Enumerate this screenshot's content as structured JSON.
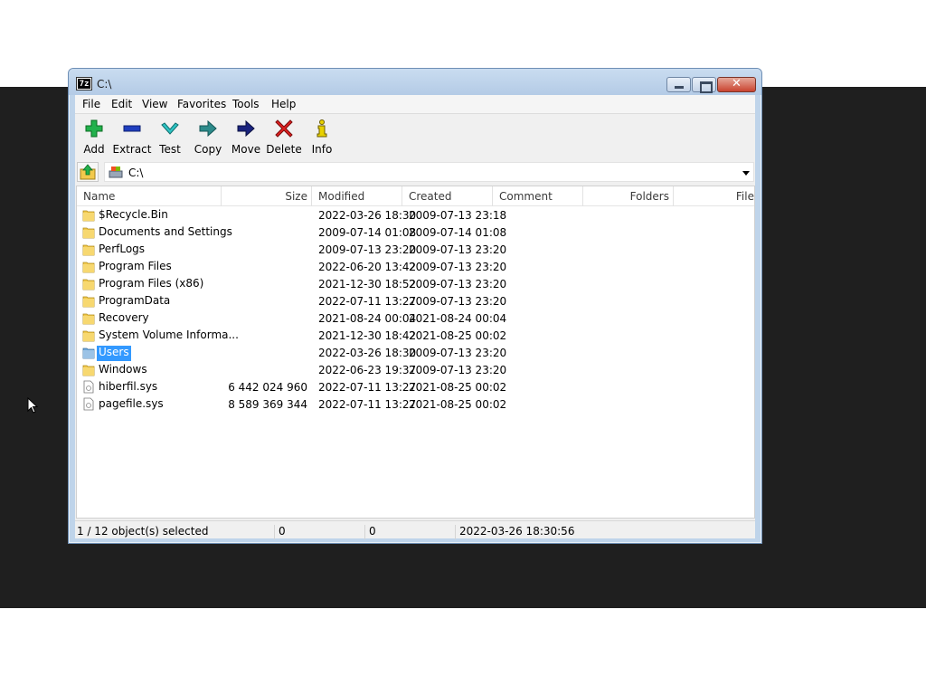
{
  "window": {
    "title": "C:\\",
    "app_icon_text": "7z"
  },
  "menu": [
    {
      "label": "File",
      "name": "menu-file"
    },
    {
      "label": "Edit",
      "name": "menu-edit"
    },
    {
      "label": "View",
      "name": "menu-view"
    },
    {
      "label": "Favorites",
      "name": "menu-favorites"
    },
    {
      "label": "Tools",
      "name": "menu-tools"
    },
    {
      "label": "Help",
      "name": "menu-help"
    }
  ],
  "toolbar": {
    "add": "Add",
    "extract": "Extract",
    "test": "Test",
    "copy": "Copy",
    "move": "Move",
    "delete": "Delete",
    "info": "Info"
  },
  "address": {
    "path": "C:\\"
  },
  "columns": {
    "name": "Name",
    "size": "Size",
    "modified": "Modified",
    "created": "Created",
    "comment": "Comment",
    "folders": "Folders",
    "files": "File"
  },
  "rows": [
    {
      "name": "$Recycle.Bin",
      "size": "",
      "modified": "2022-03-26 18:30",
      "created": "2009-07-13 23:18",
      "type": "folder"
    },
    {
      "name": "Documents and Settings",
      "size": "",
      "modified": "2009-07-14 01:08",
      "created": "2009-07-14 01:08",
      "type": "folder"
    },
    {
      "name": "PerfLogs",
      "size": "",
      "modified": "2009-07-13 23:20",
      "created": "2009-07-13 23:20",
      "type": "folder"
    },
    {
      "name": "Program Files",
      "size": "",
      "modified": "2022-06-20 13:42",
      "created": "2009-07-13 23:20",
      "type": "folder"
    },
    {
      "name": "Program Files (x86)",
      "size": "",
      "modified": "2021-12-30 18:52",
      "created": "2009-07-13 23:20",
      "type": "folder"
    },
    {
      "name": "ProgramData",
      "size": "",
      "modified": "2022-07-11 13:27",
      "created": "2009-07-13 23:20",
      "type": "folder"
    },
    {
      "name": "Recovery",
      "size": "",
      "modified": "2021-08-24 00:04",
      "created": "2021-08-24 00:04",
      "type": "folder"
    },
    {
      "name": "System Volume Informa...",
      "size": "",
      "modified": "2021-12-30 18:42",
      "created": "2021-08-25 00:02",
      "type": "folder"
    },
    {
      "name": "Users",
      "size": "",
      "modified": "2022-03-26 18:30",
      "created": "2009-07-13 23:20",
      "type": "folder",
      "selected": true
    },
    {
      "name": "Windows",
      "size": "",
      "modified": "2022-06-23 19:37",
      "created": "2009-07-13 23:20",
      "type": "folder"
    },
    {
      "name": "hiberfil.sys",
      "size": "6 442 024 960",
      "modified": "2022-07-11 13:27",
      "created": "2021-08-25 00:02",
      "type": "file"
    },
    {
      "name": "pagefile.sys",
      "size": "8 589 369 344",
      "modified": "2022-07-11 13:27",
      "created": "2021-08-25 00:02",
      "type": "file"
    }
  ],
  "status": {
    "selection": "1 / 12 object(s) selected",
    "size": "0",
    "packed": "0",
    "date": "2022-03-26 18:30:56"
  },
  "colors": {
    "desktop": "#1f1f1f",
    "selection": "#3399ff",
    "folder": "#f2c94c"
  },
  "icons": {
    "add": "plus-icon",
    "extract": "minus-icon",
    "test": "check-icon",
    "copy": "copy-arrow-icon",
    "move": "move-arrow-icon",
    "delete": "x-icon",
    "info": "info-icon"
  }
}
